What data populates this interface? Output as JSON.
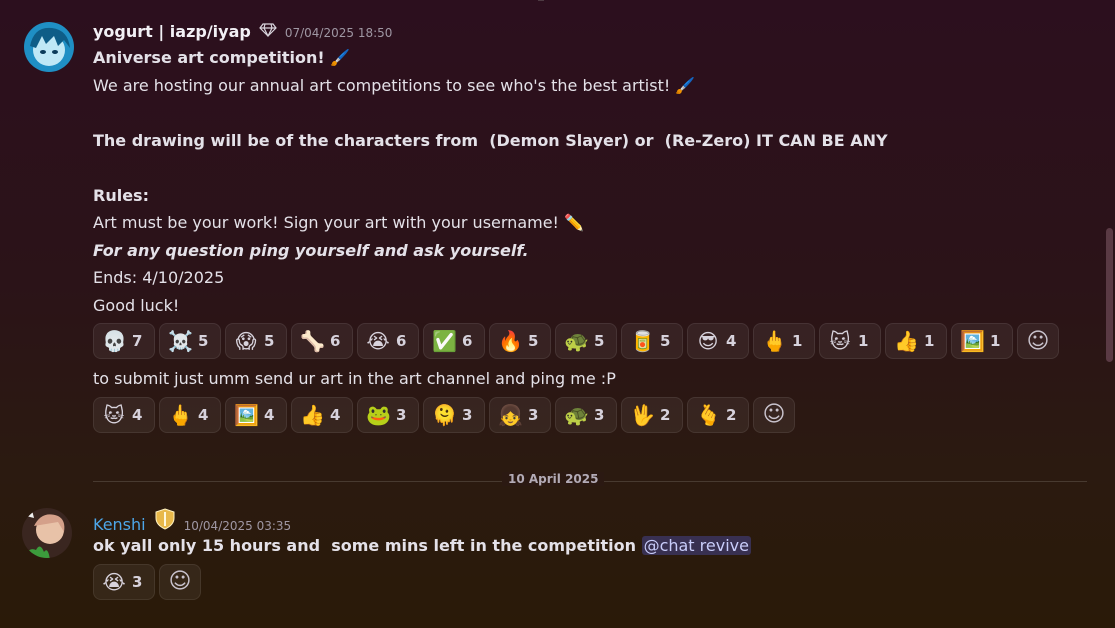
{
  "message1": {
    "author": "yogurt | iazp/iyap",
    "timestamp": "07/04/2025 18:50",
    "lines": {
      "l1": "Aniverse art competition! 🖌️",
      "l2": "We are hosting our annual art competitions to see who's the best artist! 🖌️",
      "l3": "The drawing will be of the characters from  (Demon Slayer) or  (Re-Zero) IT CAN BE ANY",
      "l4": "Rules:",
      "l5": "Art must be your work! Sign your art with your username! ✏️",
      "l6": "For any question ping yourself and ask yourself.",
      "l7": "Ends: 4/10/2025",
      "l8": "Good luck!"
    },
    "reactions": [
      {
        "emoji": "💀",
        "count": "7"
      },
      {
        "emoji": "☠️",
        "count": "5"
      },
      {
        "emoji": "😱",
        "count": "5"
      },
      {
        "emoji": "🦴",
        "count": "6"
      },
      {
        "emoji": "😭",
        "count": "6"
      },
      {
        "emoji": "✅",
        "count": "6"
      },
      {
        "emoji": "🔥",
        "count": "5"
      },
      {
        "emoji": "🐢",
        "count": "5"
      },
      {
        "emoji": "🥫",
        "count": "5"
      },
      {
        "emoji": "😎",
        "count": "4"
      },
      {
        "emoji": "🖕",
        "count": "1"
      },
      {
        "emoji": "🐱",
        "count": "1"
      },
      {
        "emoji": "👍",
        "count": "1"
      },
      {
        "emoji": "🖼️",
        "count": "1"
      }
    ],
    "follow_up": "to submit just umm send ur art in the art channel and ping me :P",
    "reactions2": [
      {
        "emoji": "🐱",
        "count": "4"
      },
      {
        "emoji": "🖕",
        "count": "4"
      },
      {
        "emoji": "🖼️",
        "count": "4"
      },
      {
        "emoji": "👍",
        "count": "4"
      },
      {
        "emoji": "🐸",
        "count": "3"
      },
      {
        "emoji": "🫠",
        "count": "3"
      },
      {
        "emoji": "👧",
        "count": "3"
      },
      {
        "emoji": "🐢",
        "count": "3"
      },
      {
        "emoji": "🖖",
        "count": "2"
      },
      {
        "emoji": "🫰",
        "count": "2"
      }
    ]
  },
  "divider": {
    "label": "10 April 2025"
  },
  "message2": {
    "author": "Kenshi",
    "timestamp": "10/04/2025 03:35",
    "text": "ok yall only 15 hours and  some mins left in the competition ",
    "mention": "@chat revive",
    "reactions": [
      {
        "emoji": "😭",
        "count": "3"
      }
    ]
  },
  "add_reaction_icon": "smiley-add-icon",
  "colors": {
    "accent_name": "#4da6e8",
    "mention_bg": "#5865f2"
  }
}
